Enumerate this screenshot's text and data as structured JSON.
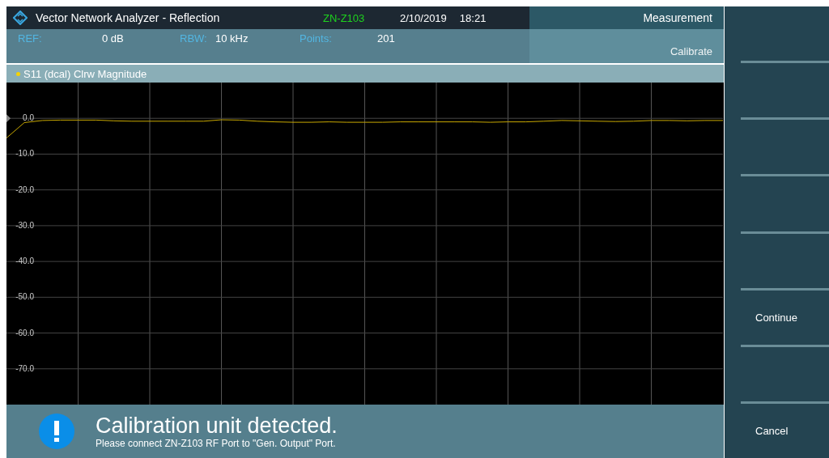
{
  "title_bar": {
    "title": "Vector Network Analyzer - Reflection",
    "device": "ZN-Z103",
    "date": "2/10/2019",
    "time": "18:21"
  },
  "mode": {
    "measurement": "Measurement",
    "submode": "Calibrate"
  },
  "settings": [
    {
      "label": "REF:",
      "value": "0 dB"
    },
    {
      "label": "RBW:",
      "value": "10 kHz"
    },
    {
      "label": "Points:",
      "value": "201"
    }
  ],
  "trace": {
    "label": "S11 (dcal) Clrw Magnitude",
    "color": "#f5d200",
    "chart_data": {
      "type": "line",
      "ylim": [
        -80,
        10
      ],
      "yticks": [
        {
          "value": 0,
          "label": "0.0"
        },
        {
          "value": -10,
          "label": "-10.0"
        },
        {
          "value": -20,
          "label": "-20.0"
        },
        {
          "value": -30,
          "label": "-30.0"
        },
        {
          "value": -40,
          "label": "-40.0"
        },
        {
          "value": -50,
          "label": "-50.0"
        },
        {
          "value": -60,
          "label": "-60.0"
        },
        {
          "value": -70,
          "label": "-70.0"
        }
      ],
      "grid": true,
      "series": [
        {
          "color": "#c8a800",
          "values": [
            -5.5,
            -1.2,
            -0.6,
            -0.5,
            -0.5,
            -0.5,
            -0.7,
            -0.8,
            -0.8,
            -0.8,
            -0.8,
            -0.8,
            -0.4,
            -0.5,
            -0.8,
            -1.0,
            -1.1,
            -1.1,
            -1.0,
            -1.1,
            -1.1,
            -1.1,
            -1.0,
            -1.0,
            -1.0,
            -1.0,
            -1.0,
            -1.1,
            -1.0,
            -1.0,
            -0.8,
            -0.6,
            -0.7,
            -0.8,
            -0.9,
            -0.8,
            -0.6,
            -0.6,
            -0.7,
            -0.6,
            -0.6
          ]
        }
      ]
    }
  },
  "message": {
    "title": "Calibration unit detected.",
    "text": "Please connect ZN-Z103 RF Port to \"Gen. Output\" Port."
  },
  "softkeys": [
    {
      "label": "Continue"
    },
    {
      "label": "Cancel"
    }
  ]
}
